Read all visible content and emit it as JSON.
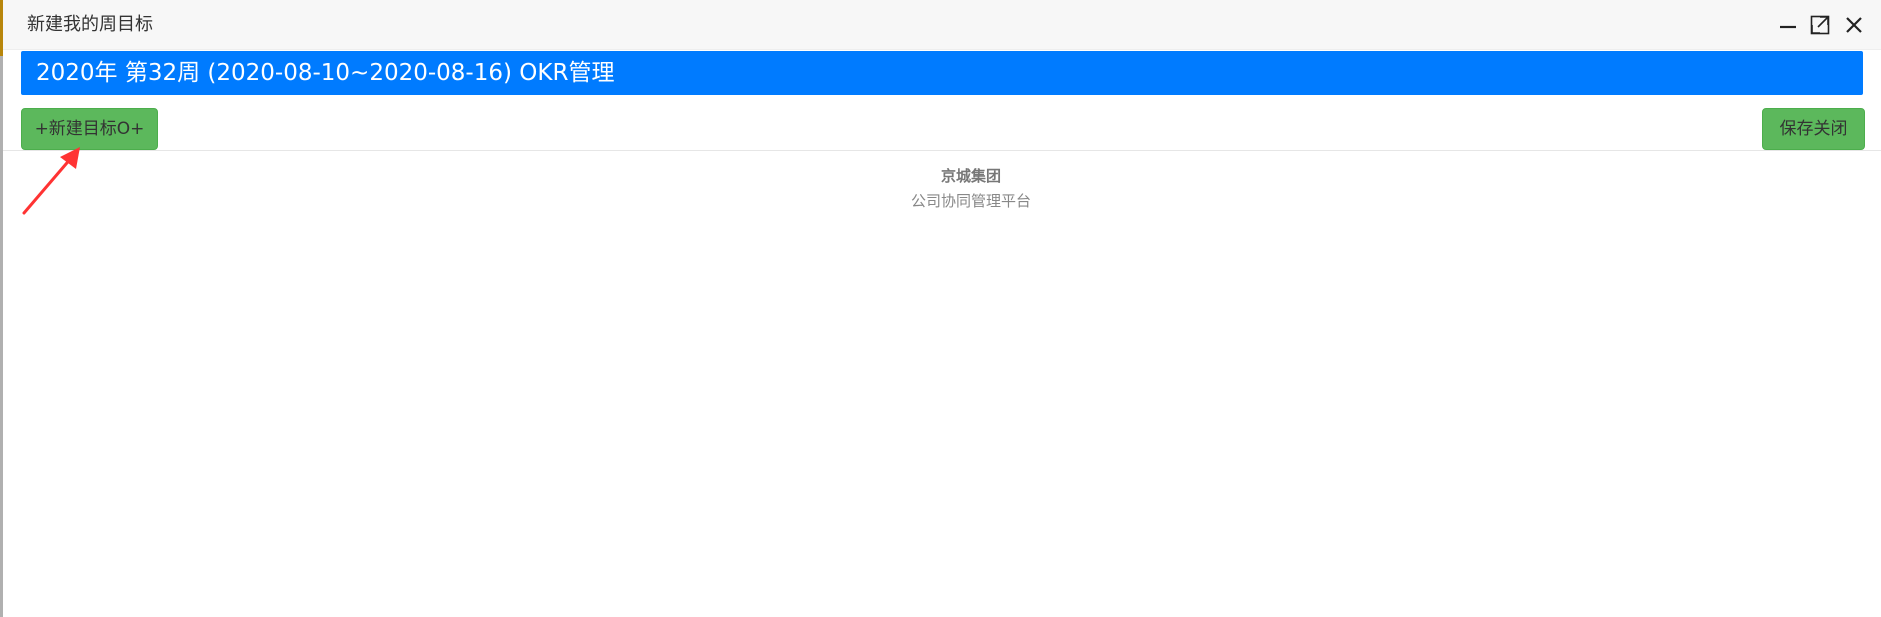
{
  "window": {
    "title": "新建我的周目标",
    "controls": {
      "minimize_icon": "minimize-icon",
      "maximize_icon": "maximize-icon",
      "close_icon": "close-icon"
    }
  },
  "header": {
    "title": "2020年 第32周 (2020-08-10~2020-08-16) OKR管理"
  },
  "toolbar": {
    "new_objective_label": "+新建目标O+",
    "save_close_label": "保存关闭"
  },
  "footer": {
    "company": "京城集团",
    "platform": "公司协同管理平台"
  },
  "colors": {
    "header_bg": "#007bff",
    "button_green": "#5cb85c",
    "annotation_arrow": "#ff3333"
  }
}
